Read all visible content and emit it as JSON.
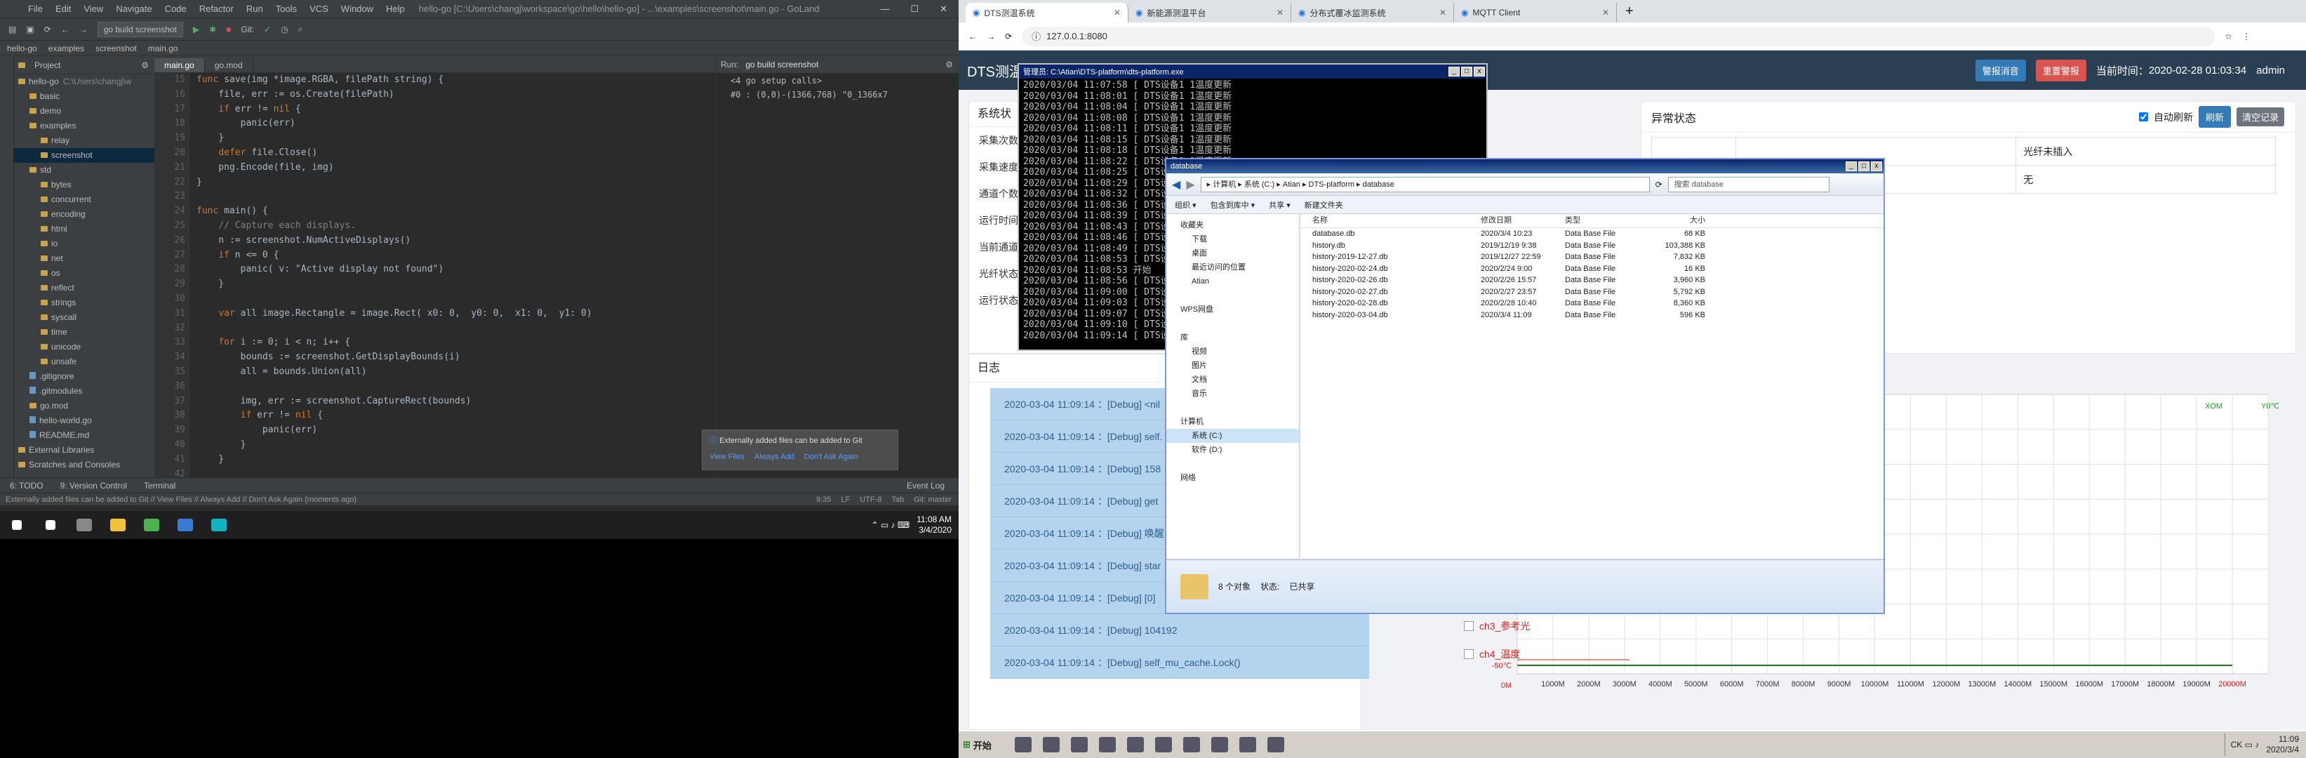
{
  "ide": {
    "title_menu": [
      "File",
      "Edit",
      "View",
      "Navigate",
      "Code",
      "Refactor",
      "Run",
      "Tools",
      "VCS",
      "Window",
      "Help"
    ],
    "title_path": "hello-go [C:\\Users\\changj\\workspace\\go\\hello\\hello-go] - ...\\examples\\screenshot\\main.go - GoLand",
    "run_config": "go build screenshot",
    "git_label": "Git:",
    "breadcrumb": [
      "hello-go",
      "examples",
      "screenshot",
      "main.go"
    ],
    "project_label": "Project",
    "tree": [
      {
        "label": "hello-go",
        "extra": "C:\\Users\\changj\\w",
        "type": "folder"
      },
      {
        "label": "basic",
        "type": "folder"
      },
      {
        "label": "demo",
        "type": "folder"
      },
      {
        "label": "examples",
        "type": "folder"
      },
      {
        "label": "relay",
        "type": "folder"
      },
      {
        "label": "screenshot",
        "type": "folder",
        "selected": true
      },
      {
        "label": "std",
        "type": "folder"
      },
      {
        "label": "bytes",
        "type": "folder"
      },
      {
        "label": "concurrent",
        "type": "folder"
      },
      {
        "label": "encoding",
        "type": "folder"
      },
      {
        "label": "html",
        "type": "folder"
      },
      {
        "label": "io",
        "type": "folder"
      },
      {
        "label": "net",
        "type": "folder"
      },
      {
        "label": "os",
        "type": "folder"
      },
      {
        "label": "reflect",
        "type": "folder"
      },
      {
        "label": "strings",
        "type": "folder"
      },
      {
        "label": "syscall",
        "type": "folder"
      },
      {
        "label": "time",
        "type": "folder"
      },
      {
        "label": "unicode",
        "type": "folder"
      },
      {
        "label": "unsafe",
        "type": "folder"
      },
      {
        "label": ".gitignore",
        "type": "file"
      },
      {
        "label": ".gitmodules",
        "type": "file"
      },
      {
        "label": "go.mod",
        "type": "folder"
      },
      {
        "label": "hello-world.go",
        "type": "file"
      },
      {
        "label": "README.md",
        "type": "file"
      },
      {
        "label": "External Libraries",
        "type": "folder"
      },
      {
        "label": "Scratches and Consoles",
        "type": "folder"
      }
    ],
    "tabs": [
      "main.go",
      "go.mod"
    ],
    "line_numbers": [
      "15",
      "16",
      "17",
      "18",
      "19",
      "20",
      "21",
      "22",
      "23",
      "24",
      "25",
      "26",
      "27",
      "28",
      "29",
      "30",
      "31",
      "32",
      "33",
      "34",
      "35",
      "36",
      "37",
      "38",
      "39",
      "40",
      "41",
      "42",
      "43"
    ],
    "code": [
      "func save(img *image.RGBA, filePath string) {",
      "    file, err := os.Create(filePath)",
      "    if err != nil {",
      "        panic(err)",
      "    }",
      "    defer file.Close()",
      "    png.Encode(file, img)",
      "}",
      "",
      "func main() {",
      "    // Capture each displays.",
      "    n := screenshot.NumActiveDisplays()",
      "    if n <= 0 {",
      "        panic( v: \"Active display not found\")",
      "    }",
      "",
      "    var all image.Rectangle = image.Rect( x0: 0,  y0: 0,  x1: 0,  y1: 0)",
      "",
      "    for i := 0; i < n; i++ {",
      "        bounds := screenshot.GetDisplayBounds(i)",
      "        all = bounds.Union(all)",
      "",
      "        img, err := screenshot.CaptureRect(bounds)",
      "        if err != nil {",
      "            panic(err)",
      "        }",
      "    }",
      "",
      ""
    ],
    "run_label": "Run:",
    "run_tab": "go build screenshot",
    "run_output": [
      "<4 go setup calls>",
      "#0 : (0,0)-(1366,768) \"0_1366x7"
    ],
    "notification": {
      "text": "Externally added files can be added to Git",
      "actions": [
        "View Files",
        "Always Add",
        "Don't Ask Again"
      ]
    },
    "bottom_tabs": [
      "6: TODO",
      "9: Version Control",
      "Terminal",
      "Event Log"
    ],
    "status_text": "Externally added files can be added to Git // View Files // Always Add // Don't Ask Again (moments ago)",
    "status_right": [
      "9:35",
      "LF",
      "UTF-8",
      "Tab",
      "Git: master"
    ]
  },
  "win_taskbar": {
    "time": "11:08 AM",
    "date": "3/4/2020",
    "apps": [
      {
        "name": "start-icon",
        "color": "#ffffff"
      },
      {
        "name": "search-icon",
        "color": "#ffffff"
      },
      {
        "name": "app-icon",
        "color": "#888888"
      },
      {
        "name": "explorer-icon",
        "color": "#f3c13a"
      },
      {
        "name": "chrome-icon",
        "color": "#4caf50"
      },
      {
        "name": "mail-icon",
        "color": "#3b7bd4"
      },
      {
        "name": "goland-icon",
        "color": "#12b4c4"
      }
    ]
  },
  "browser": {
    "tabs": [
      "DTS测温系统",
      "新能源测温平台",
      "分布式覆冰监测系统",
      "MQTT Client"
    ],
    "url": "127.0.0.1:8080"
  },
  "app": {
    "brand": "DTS测温",
    "btn_alarm_sound": "警报消音",
    "btn_reset_alarm": "重置警报",
    "current_time_label": "当前时间：",
    "current_time": "2020-02-28 01:03:34",
    "user": "admin",
    "sys_title": "系统状",
    "sys_rows": [
      "采集次数",
      "采集速度",
      "通道个数",
      "运行时间",
      "当前通道",
      "光纤状态",
      "运行状态"
    ],
    "abn_title": "异常状态",
    "auto_refresh": "自动刷新",
    "btn_refresh": "刷新",
    "btn_clear": "清空记录",
    "abn_table": [
      [
        "",
        "",
        "光纤未插入"
      ],
      [
        "",
        "",
        "无"
      ]
    ],
    "log_title": "日志",
    "logs": [
      "2020-03-04 11:09:14 ：[Debug] <nil",
      "2020-03-04 11:09:14 ：[Debug] self.",
      "2020-03-04 11:09:14 ：[Debug] 158",
      "2020-03-04 11:09:14 ：[Debug] get",
      "2020-03-04 11:09:14 ：[Debug] 唤醒",
      "2020-03-04 11:09:14 ：[Debug] star",
      "2020-03-04 11:09:14 ：[Debug] [0]",
      "2020-03-04 11:09:14 ：[Debug] 104192",
      "2020-03-04 11:09:14 ：[Debug] self_mu_cache.Lock()"
    ],
    "channels": [
      "ch3_参考光",
      "ch4_温度"
    ]
  },
  "chart_data": {
    "type": "line",
    "title": "",
    "x": [
      "1000M",
      "2000M",
      "3000M",
      "4000M",
      "5000M",
      "6000M",
      "7000M",
      "8000M",
      "9000M",
      "10000M",
      "11000M",
      "12000M",
      "13000M",
      "14000M",
      "15000M",
      "16000M",
      "17000M",
      "18000M",
      "19000M",
      "20000M"
    ],
    "y_axis_labels": [
      "-50℃",
      "0M"
    ],
    "legend": [
      "XOM",
      "Y0℃"
    ],
    "series": [
      {
        "values": [
          0,
          0,
          0,
          0,
          0,
          0,
          0,
          0,
          0,
          0,
          0,
          0,
          0,
          0,
          0,
          0,
          0,
          0,
          0,
          0
        ]
      }
    ],
    "colors": {
      "line": "#1a7a1a",
      "axis_red": "#e02020",
      "legend_green": "#1aa31a"
    }
  },
  "cmd": {
    "title": "管理员: C:\\Atian\\DTS-platform\\dts-platform.exe",
    "lines": [
      "2020/03/04 11:07:58 [ DTS设备1 1温度更新",
      "2020/03/04 11:08:01 [ DTS设备1 1温度更新",
      "2020/03/04 11:08:04 [ DTS设备1 1温度更新",
      "2020/03/04 11:08:08 [ DTS设备1 1温度更新",
      "2020/03/04 11:08:11 [ DTS设备1 1温度更新",
      "2020/03/04 11:08:15 [ DTS设备1 1温度更新",
      "2020/03/04 11:08:18 [ DTS设备1 1温度更新",
      "2020/03/04 11:08:22 [ DTS设备1 1温度更新",
      "2020/03/04 11:08:25 [ DTS设备1 1温度更新",
      "2020/03/04 11:08:29 [ DTS设备1 1温度更新",
      "2020/03/04 11:08:32 [ DTS设备1 1温度更新",
      "2020/03/04 11:08:36 [ DTS设备1 1温度更新",
      "2020/03/04 11:08:39 [ DTS设备1 1温度更新",
      "2020/03/04 11:08:43 [ DTS设备1 1温度更新",
      "2020/03/04 11:08:46 [ DTS设备1 1温度更新",
      "2020/03/04 11:08:49 [ DTS设备1 1温度更新",
      "2020/03/04 11:08:53 [ DTS设备1 1温度更新",
      "2020/03/04 11:08:53 开始",
      "2020/03/04 11:08:56 [ DTS设备1 1温度更新",
      "2020/03/04 11:09:00 [ DTS设备1 1温度更新",
      "2020/03/04 11:09:03 [ DTS设备1 1温度更新",
      "2020/03/04 11:09:07 [ DTS设备1 1温度更新",
      "2020/03/04 11:09:10 [ DTS设备1 1温度更新",
      "2020/03/04 11:09:14 [ DTS设备1 1温度更新"
    ]
  },
  "explorer": {
    "title": "database",
    "breadcrumb": "▸ 计算机 ▸ 系统 (C:) ▸ Atian ▸ DTS-platform ▸ database",
    "search": "搜索 database",
    "cmdbar": [
      "组织 ▾",
      "包含到库中 ▾",
      "共享 ▾",
      "新建文件夹"
    ],
    "nav": [
      {
        "label": "收藏夹",
        "sub": false
      },
      {
        "label": "下载",
        "sub": true
      },
      {
        "label": "桌面",
        "sub": true
      },
      {
        "label": "最近访问的位置",
        "sub": true
      },
      {
        "label": "Atian",
        "sub": true
      },
      {
        "label": "",
        "sub": false
      },
      {
        "label": "WPS网盘",
        "sub": false
      },
      {
        "label": "",
        "sub": false
      },
      {
        "label": "库",
        "sub": false
      },
      {
        "label": "视频",
        "sub": true
      },
      {
        "label": "图片",
        "sub": true
      },
      {
        "label": "文档",
        "sub": true
      },
      {
        "label": "音乐",
        "sub": true
      },
      {
        "label": "",
        "sub": false
      },
      {
        "label": "计算机",
        "sub": false
      },
      {
        "label": "系统 (C:)",
        "sub": true,
        "selected": true
      },
      {
        "label": "软件 (D:)",
        "sub": true
      },
      {
        "label": "",
        "sub": false
      },
      {
        "label": "网络",
        "sub": false
      }
    ],
    "columns": [
      "名称",
      "修改日期",
      "类型",
      "大小"
    ],
    "files": [
      [
        "database.db",
        "2020/3/4 10:23",
        "Data Base File",
        "68 KB"
      ],
      [
        "history.db",
        "2019/12/19 9:38",
        "Data Base File",
        "103,388 KB"
      ],
      [
        "history-2019-12-27.db",
        "2019/12/27 22:59",
        "Data Base File",
        "7,832 KB"
      ],
      [
        "history-2020-02-24.db",
        "2020/2/24 9:00",
        "Data Base File",
        "16 KB"
      ],
      [
        "history-2020-02-26.db",
        "2020/2/26 15:57",
        "Data Base File",
        "3,960 KB"
      ],
      [
        "history-2020-02-27.db",
        "2020/2/27 23:57",
        "Data Base File",
        "5,792 KB"
      ],
      [
        "history-2020-02-28.db",
        "2020/2/28 10:40",
        "Data Base File",
        "8,360 KB"
      ],
      [
        "history-2020-03-04.db",
        "2020/3/4 11:09",
        "Data Base File",
        "596 KB"
      ]
    ],
    "status_count": "8 个对象",
    "status_label": "状态:",
    "status_value": "已共享"
  },
  "xp_taskbar": {
    "start": "开始",
    "time": "11:09",
    "date": "2020/3/4"
  }
}
